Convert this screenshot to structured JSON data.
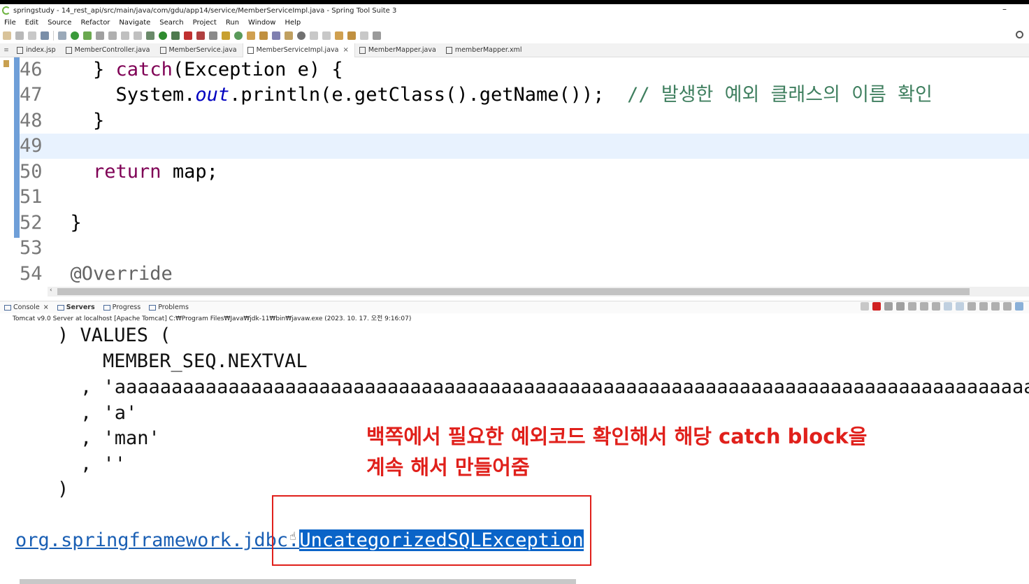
{
  "window": {
    "title": "springstudy - 14_rest_api/src/main/java/com/gdu/app14/service/MemberServiceImpl.java - Spring Tool Suite 3",
    "minimize": "–"
  },
  "menu": [
    "File",
    "Edit",
    "Source",
    "Refactor",
    "Navigate",
    "Search",
    "Project",
    "Run",
    "Window",
    "Help"
  ],
  "editor_tabs": [
    {
      "label": "index.jsp",
      "active": false
    },
    {
      "label": "MemberController.java",
      "active": false
    },
    {
      "label": "MemberService.java",
      "active": false
    },
    {
      "label": "MemberServiceImpl.java",
      "active": true,
      "close": "×"
    },
    {
      "label": "MemberMapper.java",
      "active": false
    },
    {
      "label": "memberMapper.xml",
      "active": false
    }
  ],
  "code": {
    "lines": [
      {
        "num": "46",
        "indent": "    ",
        "p1": "} ",
        "kw": "catch",
        "p2": "(Exception e) {"
      },
      {
        "num": "47",
        "indent": "      ",
        "p1": "System.",
        "field": "out",
        "p2": ".println(e.getClass().getName());  ",
        "comment": "// 발생한 예외 클래스의 이름 확인"
      },
      {
        "num": "48",
        "indent": "    ",
        "p1": "}"
      },
      {
        "num": "49",
        "indent": "",
        "p1": ""
      },
      {
        "num": "50",
        "indent": "    ",
        "kw": "return",
        "p2": " map;"
      },
      {
        "num": "51",
        "indent": "",
        "p1": ""
      },
      {
        "num": "52",
        "indent": "  ",
        "p1": "}"
      },
      {
        "num": "53",
        "indent": "",
        "p1": ""
      },
      {
        "num": "54",
        "indent": "  ",
        "ann": "@Override"
      }
    ]
  },
  "console": {
    "tabs": [
      {
        "label": "Console",
        "close": "×",
        "bold": false
      },
      {
        "label": "Servers",
        "bold": true
      },
      {
        "label": "Progress",
        "bold": false
      },
      {
        "label": "Problems",
        "bold": false
      }
    ],
    "info": "Tomcat v9.0 Server at localhost [Apache Tomcat] C:₩Program Files₩Java₩jdk-11₩bin₩javaw.exe  (2023. 10. 17. 오전 9:16:07)",
    "lines": [
      ") VALUES (",
      "MEMBER_SEQ.NEXTVAL",
      ", 'aaaaaaaaaaaaaaaaaaaaaaaaaaaaaaaaaaaaaaaaaaaaaaaaaaaaaaaaaaaaaaaaaaaaaaaaaaaaaaaaaaaaaaaaaaaaaaaaaaaaaaaaaaaaa",
      ", 'a'",
      ", 'man'",
      ", ''",
      ")"
    ],
    "exception_pkg": "org.springframework.jdbc.",
    "exception_cls": "UncategorizedSQLException"
  },
  "annotation": {
    "line1": "백쪽에서 필요한 예외코드 확인해서 해당 catch block을",
    "line2": "계속 해서 만들어줌",
    "color": "#e0201b"
  }
}
